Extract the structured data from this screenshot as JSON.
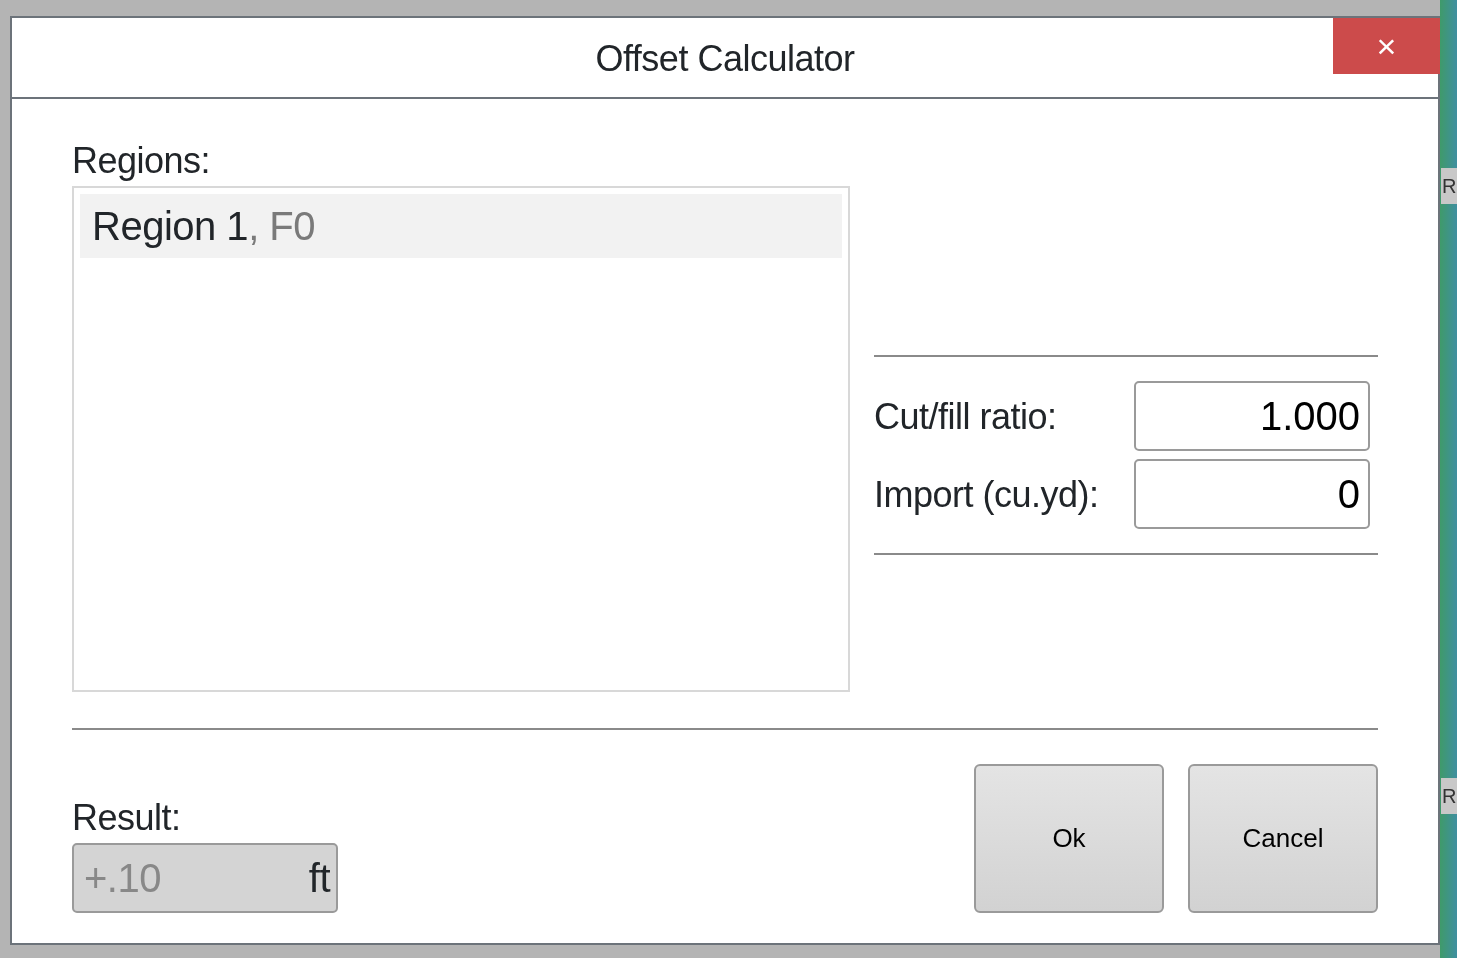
{
  "background_labels": [
    "R",
    "R"
  ],
  "dialog": {
    "title": "Offset Calculator",
    "close": "×"
  },
  "regions": {
    "label": "Regions:",
    "items": [
      {
        "name": "Region 1",
        "suffix": ", F0",
        "selected": true
      }
    ]
  },
  "fields": [
    {
      "label": "Cut/fill ratio:",
      "value": "1.000"
    },
    {
      "label": "Import (cu.yd):",
      "value": "0"
    }
  ],
  "result": {
    "label": "Result:",
    "value": "+.10",
    "unit": "ft",
    "disabled": true
  },
  "buttons": [
    "Ok",
    "Cancel"
  ]
}
